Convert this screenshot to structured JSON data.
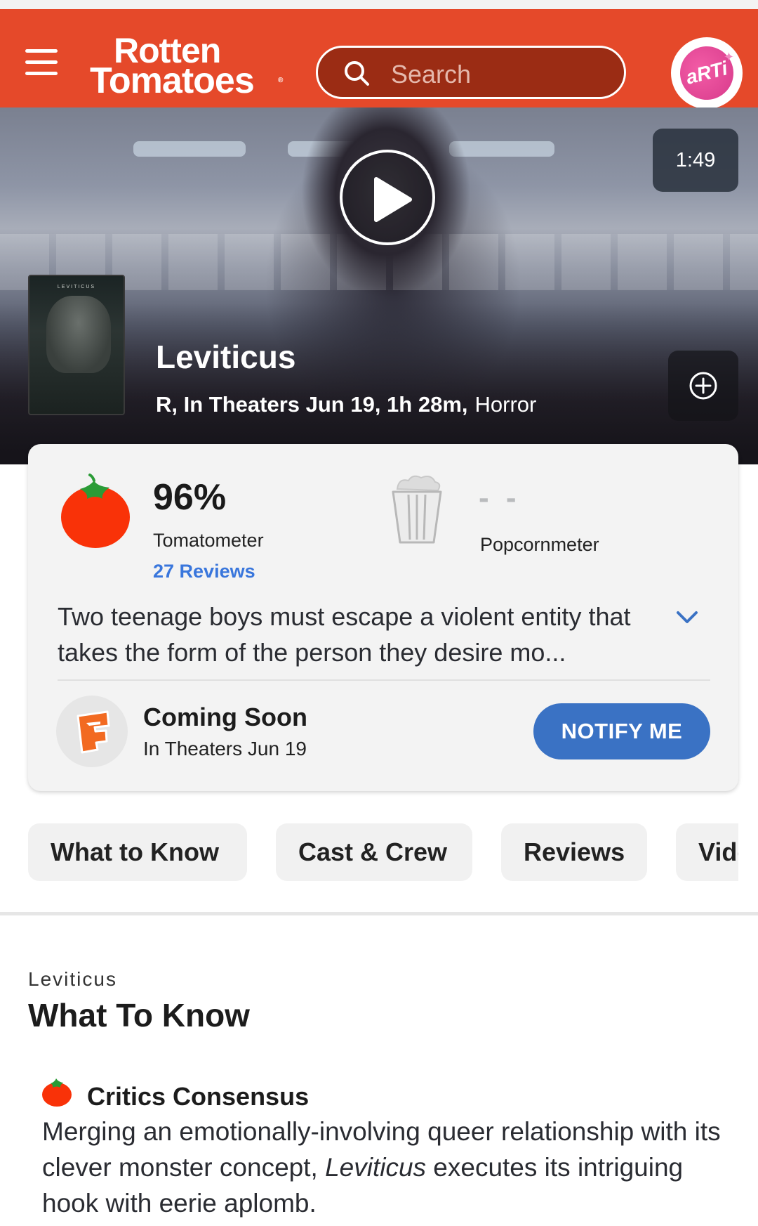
{
  "header": {
    "logo_line1": "Rotten",
    "logo_line2": "Tomatoes",
    "logo_mark": "®",
    "search_placeholder": "Search",
    "avatar_text": "aRTi",
    "brand_color": "#e5492a"
  },
  "hero": {
    "duration": "1:49",
    "poster_title": "LEVITICUS",
    "title": "Leviticus",
    "meta": "R, In Theaters Jun 19, 1h 28m,",
    "genre": "Horror",
    "icons": [
      "play-icon",
      "add-circle-icon"
    ]
  },
  "scores": {
    "tomatometer_value": "96%",
    "tomatometer_label": "Tomatometer",
    "reviews_link": "27 Reviews",
    "popcornmeter_value": "- -",
    "popcornmeter_label": "Popcornmeter",
    "icons": [
      "tomato-icon",
      "empty-popcorn-icon"
    ]
  },
  "synopsis": "Two teenage boys must escape a violent entity that takes the form of the person they desire mo...",
  "showtimes": {
    "title": "Coming Soon",
    "subtitle": "In Theaters Jun 19",
    "button": "NOTIFY ME",
    "button_color": "#3a72c4"
  },
  "tabs": [
    "What to Know",
    "Cast & Crew",
    "Reviews",
    "Videos"
  ],
  "what_to_know": {
    "kicker": "Leviticus",
    "title": "What To Know",
    "consensus_title": "Critics Consensus",
    "consensus_before": "Merging an emotionally-involving queer relationship with its clever monster concept, ",
    "consensus_italic": "Leviticus",
    "consensus_after": " executes its intriguing hook with eerie aplomb."
  }
}
